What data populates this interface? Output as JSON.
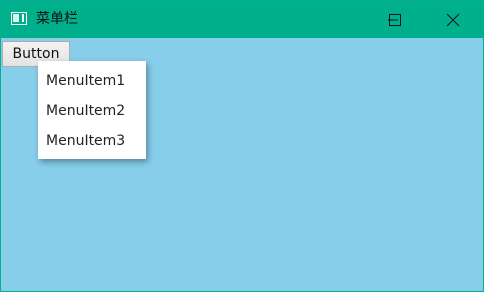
{
  "window": {
    "title": "菜单栏",
    "background_color": "#87ceeb",
    "titlebar_color": "#00af8c",
    "controls": {
      "minimize_icon": "minimize-icon",
      "maximize_icon": "maximize-icon",
      "close_icon": "close-icon"
    }
  },
  "button": {
    "label": "Button"
  },
  "context_menu": {
    "items": [
      {
        "label": "MenuItem1"
      },
      {
        "label": "MenuItem2"
      },
      {
        "label": "MenuItem3"
      }
    ]
  }
}
